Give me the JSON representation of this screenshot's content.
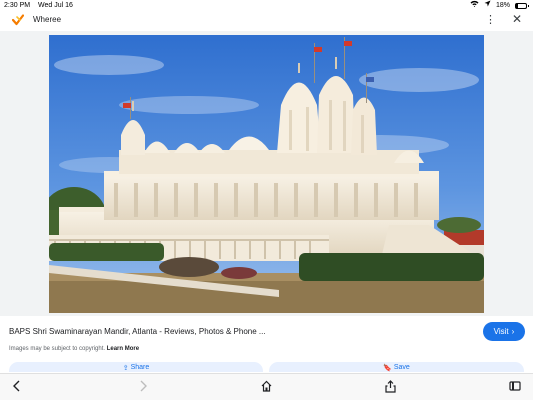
{
  "status_bar": {
    "time": "2:30 PM",
    "date": "Wed Jul 16",
    "battery_percent": "18%",
    "battery_level": 0.18,
    "icons": [
      "wifi-icon",
      "location-arrow-icon",
      "battery-icon"
    ]
  },
  "header": {
    "app_name": "Wheree",
    "app_icon": "wheree-logo-icon",
    "more_icon": "more-vert-icon",
    "close_icon": "close-icon"
  },
  "result": {
    "title": "BAPS Shri Swaminarayan Mandir, Atlanta - Reviews, Photos & Phone ...",
    "visit_label": "Visit",
    "copyright_text": "Images may be subject to copyright.",
    "learn_more": "Learn More",
    "share_label": "Share",
    "save_label": "Save"
  },
  "toolbar": {
    "icons": [
      "back-arrow-icon",
      "forward-arrow-icon",
      "home-icon",
      "share-icon",
      "tabs-icon"
    ]
  },
  "colors": {
    "accent": "#1a73e8",
    "chip_background": "#e8f0fe",
    "image_background": "#f1f3f4",
    "sky": "#3f7fd8",
    "temple_marble": "#efe6d6",
    "logo": "#f57c00"
  }
}
